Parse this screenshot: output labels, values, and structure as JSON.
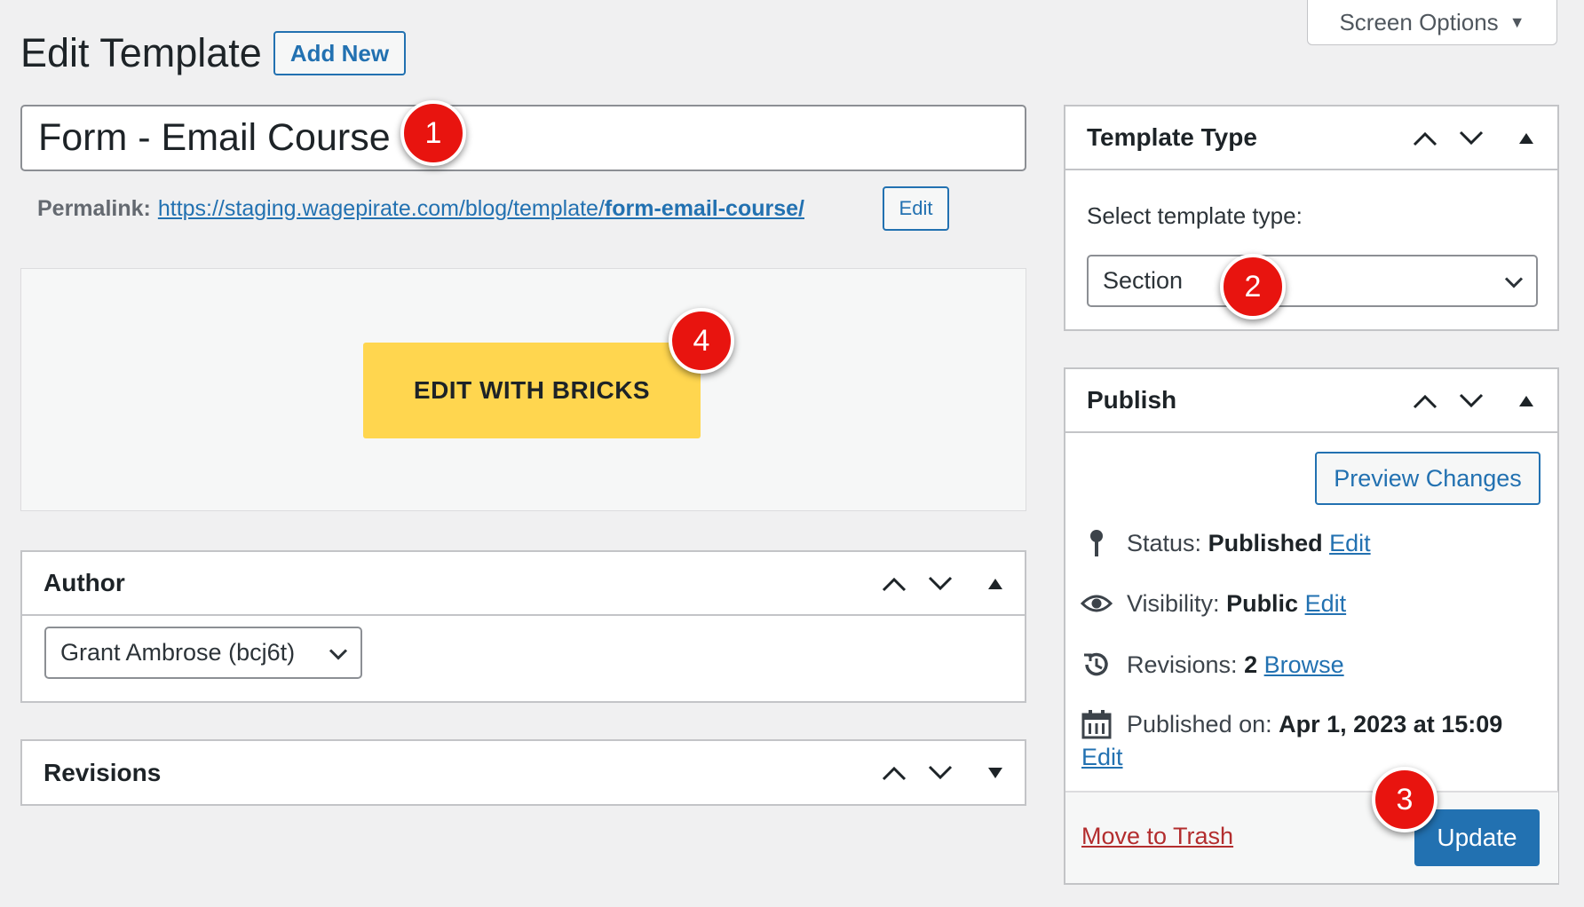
{
  "header": {
    "title": "Edit Template",
    "add_new_label": "Add New",
    "screen_options_label": "Screen Options"
  },
  "editor": {
    "title_value": "Form - Email Course",
    "permalink_label": "Permalink:",
    "permalink_base": "https://staging.wagepirate.com/blog/template/",
    "permalink_slug": "form-email-course/",
    "permalink_edit_label": "Edit",
    "builder_button_label": "EDIT WITH BRICKS"
  },
  "author_box": {
    "title": "Author",
    "selected_author": "Grant Ambrose (bcj6t)"
  },
  "revisions_box": {
    "title": "Revisions"
  },
  "template_type_box": {
    "title": "Template Type",
    "prompt": "Select template type:",
    "selected_type": "Section"
  },
  "publish_box": {
    "title": "Publish",
    "preview_label": "Preview Changes",
    "status_label": "Status:",
    "status_value": "Published",
    "visibility_label": "Visibility:",
    "visibility_value": "Public",
    "revisions_label": "Revisions:",
    "revisions_value": "2",
    "browse_label": "Browse",
    "published_on_label": "Published on:",
    "published_on_value": "Apr 1, 2023 at 15:09",
    "edit_label": "Edit",
    "trash_label": "Move to Trash",
    "update_label": "Update"
  },
  "annotations": [
    "1",
    "2",
    "3",
    "4"
  ],
  "colors": {
    "accent": "#2271b1",
    "builder_button": "#ffd64f",
    "badge": "#e8140f",
    "trash": "#b32d2e"
  }
}
